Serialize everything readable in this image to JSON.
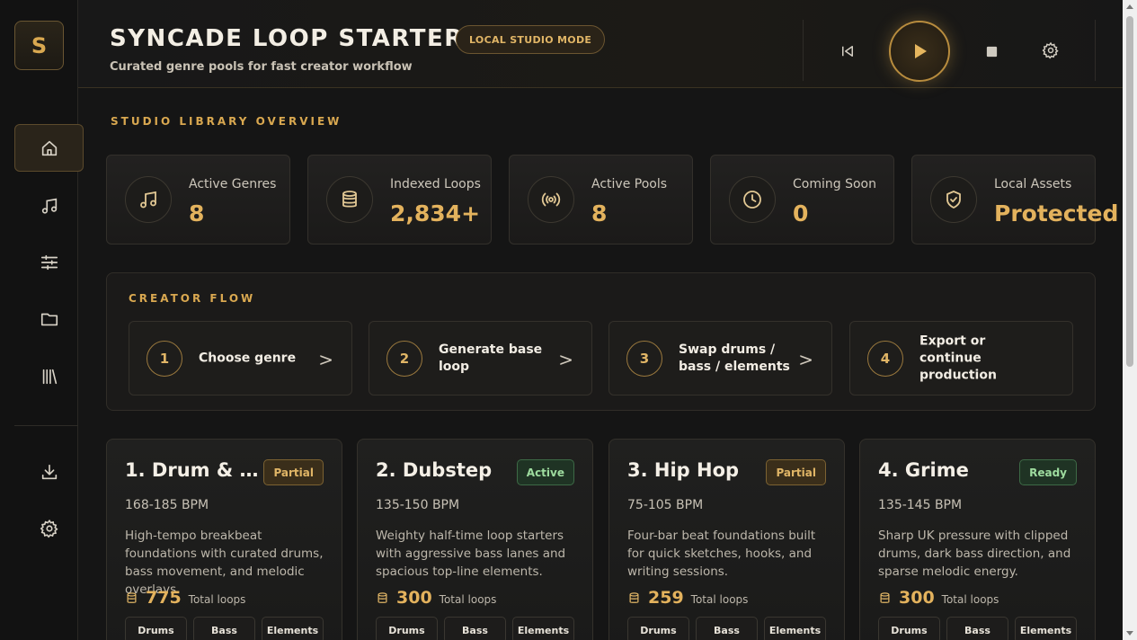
{
  "app": {
    "logo_letter": "S",
    "title": "SYNCADE LOOP STARTER",
    "subtitle": "Curated genre pools for fast creator workflow",
    "mode_badge": "LOCAL STUDIO MODE"
  },
  "sidebar": {
    "items": [
      {
        "name": "home",
        "icon": "home-icon",
        "active": true
      },
      {
        "name": "music",
        "icon": "music-note-icon",
        "active": false
      },
      {
        "name": "mixer",
        "icon": "sliders-icon",
        "active": false
      },
      {
        "name": "folder",
        "icon": "folder-icon",
        "active": false
      },
      {
        "name": "library",
        "icon": "library-icon",
        "active": false
      }
    ],
    "bottom_items": [
      {
        "name": "download",
        "icon": "download-icon"
      },
      {
        "name": "settings",
        "icon": "gear-icon"
      }
    ]
  },
  "transport": {
    "buttons": [
      "skip-back-icon",
      "play-icon",
      "stop-icon",
      "gear-icon"
    ]
  },
  "overview": {
    "title": "STUDIO LIBRARY OVERVIEW",
    "stats": [
      {
        "label": "Active Genres",
        "value": "8",
        "icon": "music-note-icon"
      },
      {
        "label": "Indexed Loops",
        "value": "2,834+",
        "icon": "database-icon"
      },
      {
        "label": "Active Pools",
        "value": "8",
        "icon": "broadcast-icon"
      },
      {
        "label": "Coming Soon",
        "value": "0",
        "icon": "clock-icon"
      },
      {
        "label": "Local Assets",
        "value": "Protected",
        "icon": "shield-check-icon"
      }
    ]
  },
  "flow": {
    "title": "CREATOR FLOW",
    "steps": [
      {
        "num": "1",
        "label": "Choose genre",
        "arrow": ">"
      },
      {
        "num": "2",
        "label": "Generate base loop",
        "arrow": ">"
      },
      {
        "num": "3",
        "label": "Swap drums / bass / elements",
        "arrow": ">"
      },
      {
        "num": "4",
        "label": "Export or continue production",
        "arrow": ""
      }
    ]
  },
  "genres": [
    {
      "name": "1. Drum & B...",
      "badge": "Partial",
      "bpm": "168-185 BPM",
      "desc": "High-tempo breakbeat foundations with curated drums, bass movement, and melodic overlays.",
      "count": "775",
      "count_label": "Total loops",
      "tags": [
        "Drums",
        "Bass",
        "Elements"
      ]
    },
    {
      "name": "2. Dubstep",
      "badge": "Active",
      "bpm": "135-150 BPM",
      "desc": "Weighty half-time loop starters with aggressive bass lanes and spacious top-line elements.",
      "count": "300",
      "count_label": "Total loops",
      "tags": [
        "Drums",
        "Bass",
        "Elements"
      ]
    },
    {
      "name": "3. Hip Hop",
      "badge": "Partial",
      "bpm": "75-105 BPM",
      "desc": "Four-bar beat foundations built for quick sketches, hooks, and writing sessions.",
      "count": "259",
      "count_label": "Total loops",
      "tags": [
        "Drums",
        "Bass",
        "Elements"
      ]
    },
    {
      "name": "4. Grime",
      "badge": "Ready",
      "bpm": "135-145 BPM",
      "desc": "Sharp UK pressure with clipped drums, dark bass direction, and sparse melodic energy.",
      "count": "300",
      "count_label": "Total loops",
      "tags": [
        "Drums",
        "Bass",
        "Elements"
      ]
    }
  ],
  "colors": {
    "accent": "#d9a850",
    "background": "#151515",
    "badge_green": "#9edc9f"
  }
}
